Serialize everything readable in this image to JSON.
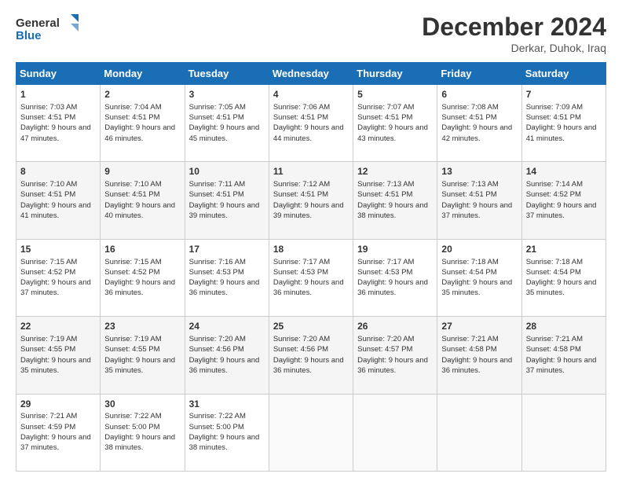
{
  "header": {
    "logo_line1": "General",
    "logo_line2": "Blue",
    "month_title": "December 2024",
    "location": "Derkar, Duhok, Iraq"
  },
  "days_of_week": [
    "Sunday",
    "Monday",
    "Tuesday",
    "Wednesday",
    "Thursday",
    "Friday",
    "Saturday"
  ],
  "weeks": [
    [
      {
        "day": 1,
        "sunrise": "7:03 AM",
        "sunset": "4:51 PM",
        "daylight": "9 hours and 47 minutes."
      },
      {
        "day": 2,
        "sunrise": "7:04 AM",
        "sunset": "4:51 PM",
        "daylight": "9 hours and 46 minutes."
      },
      {
        "day": 3,
        "sunrise": "7:05 AM",
        "sunset": "4:51 PM",
        "daylight": "9 hours and 45 minutes."
      },
      {
        "day": 4,
        "sunrise": "7:06 AM",
        "sunset": "4:51 PM",
        "daylight": "9 hours and 44 minutes."
      },
      {
        "day": 5,
        "sunrise": "7:07 AM",
        "sunset": "4:51 PM",
        "daylight": "9 hours and 43 minutes."
      },
      {
        "day": 6,
        "sunrise": "7:08 AM",
        "sunset": "4:51 PM",
        "daylight": "9 hours and 42 minutes."
      },
      {
        "day": 7,
        "sunrise": "7:09 AM",
        "sunset": "4:51 PM",
        "daylight": "9 hours and 41 minutes."
      }
    ],
    [
      {
        "day": 8,
        "sunrise": "7:10 AM",
        "sunset": "4:51 PM",
        "daylight": "9 hours and 41 minutes."
      },
      {
        "day": 9,
        "sunrise": "7:10 AM",
        "sunset": "4:51 PM",
        "daylight": "9 hours and 40 minutes."
      },
      {
        "day": 10,
        "sunrise": "7:11 AM",
        "sunset": "4:51 PM",
        "daylight": "9 hours and 39 minutes."
      },
      {
        "day": 11,
        "sunrise": "7:12 AM",
        "sunset": "4:51 PM",
        "daylight": "9 hours and 39 minutes."
      },
      {
        "day": 12,
        "sunrise": "7:13 AM",
        "sunset": "4:51 PM",
        "daylight": "9 hours and 38 minutes."
      },
      {
        "day": 13,
        "sunrise": "7:13 AM",
        "sunset": "4:51 PM",
        "daylight": "9 hours and 37 minutes."
      },
      {
        "day": 14,
        "sunrise": "7:14 AM",
        "sunset": "4:52 PM",
        "daylight": "9 hours and 37 minutes."
      }
    ],
    [
      {
        "day": 15,
        "sunrise": "7:15 AM",
        "sunset": "4:52 PM",
        "daylight": "9 hours and 37 minutes."
      },
      {
        "day": 16,
        "sunrise": "7:15 AM",
        "sunset": "4:52 PM",
        "daylight": "9 hours and 36 minutes."
      },
      {
        "day": 17,
        "sunrise": "7:16 AM",
        "sunset": "4:53 PM",
        "daylight": "9 hours and 36 minutes."
      },
      {
        "day": 18,
        "sunrise": "7:17 AM",
        "sunset": "4:53 PM",
        "daylight": "9 hours and 36 minutes."
      },
      {
        "day": 19,
        "sunrise": "7:17 AM",
        "sunset": "4:53 PM",
        "daylight": "9 hours and 36 minutes."
      },
      {
        "day": 20,
        "sunrise": "7:18 AM",
        "sunset": "4:54 PM",
        "daylight": "9 hours and 35 minutes."
      },
      {
        "day": 21,
        "sunrise": "7:18 AM",
        "sunset": "4:54 PM",
        "daylight": "9 hours and 35 minutes."
      }
    ],
    [
      {
        "day": 22,
        "sunrise": "7:19 AM",
        "sunset": "4:55 PM",
        "daylight": "9 hours and 35 minutes."
      },
      {
        "day": 23,
        "sunrise": "7:19 AM",
        "sunset": "4:55 PM",
        "daylight": "9 hours and 35 minutes."
      },
      {
        "day": 24,
        "sunrise": "7:20 AM",
        "sunset": "4:56 PM",
        "daylight": "9 hours and 36 minutes."
      },
      {
        "day": 25,
        "sunrise": "7:20 AM",
        "sunset": "4:56 PM",
        "daylight": "9 hours and 36 minutes."
      },
      {
        "day": 26,
        "sunrise": "7:20 AM",
        "sunset": "4:57 PM",
        "daylight": "9 hours and 36 minutes."
      },
      {
        "day": 27,
        "sunrise": "7:21 AM",
        "sunset": "4:58 PM",
        "daylight": "9 hours and 36 minutes."
      },
      {
        "day": 28,
        "sunrise": "7:21 AM",
        "sunset": "4:58 PM",
        "daylight": "9 hours and 37 minutes."
      }
    ],
    [
      {
        "day": 29,
        "sunrise": "7:21 AM",
        "sunset": "4:59 PM",
        "daylight": "9 hours and 37 minutes."
      },
      {
        "day": 30,
        "sunrise": "7:22 AM",
        "sunset": "5:00 PM",
        "daylight": "9 hours and 38 minutes."
      },
      {
        "day": 31,
        "sunrise": "7:22 AM",
        "sunset": "5:00 PM",
        "daylight": "9 hours and 38 minutes."
      },
      null,
      null,
      null,
      null
    ]
  ]
}
